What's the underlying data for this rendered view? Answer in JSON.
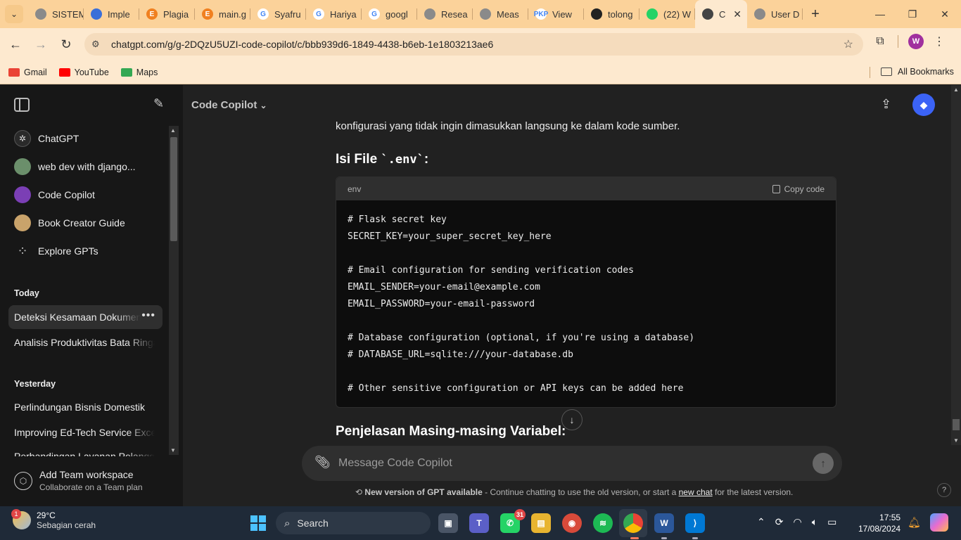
{
  "browser": {
    "tabs": [
      {
        "title": "SISTEM",
        "fav_color": "#8a8a8a",
        "fav_glyph": ""
      },
      {
        "title": "Imple",
        "fav_color": "#3a6fd8",
        "fav_glyph": ""
      },
      {
        "title": "Plagia",
        "fav_color": "#f08020",
        "fav_glyph": "E"
      },
      {
        "title": "main.g",
        "fav_color": "#f08020",
        "fav_glyph": "E"
      },
      {
        "title": "Syafru",
        "fav_color": "#ffffff",
        "fav_glyph": "G"
      },
      {
        "title": "Hariya",
        "fav_color": "#ffffff",
        "fav_glyph": "G"
      },
      {
        "title": "googl",
        "fav_color": "#ffffff",
        "fav_glyph": "G"
      },
      {
        "title": "Resea",
        "fav_color": "#8a8a8a",
        "fav_glyph": ""
      },
      {
        "title": "Meas",
        "fav_color": "#8a8a8a",
        "fav_glyph": ""
      },
      {
        "title": "View",
        "fav_color": "#ffffff",
        "fav_glyph": "PKP"
      },
      {
        "title": "tolong",
        "fav_color": "#222222",
        "fav_glyph": ""
      },
      {
        "title": "(22) W",
        "fav_color": "#25d366",
        "fav_glyph": ""
      },
      {
        "title": "C",
        "fav_color": "#444444",
        "fav_glyph": "",
        "active": true
      },
      {
        "title": "User D",
        "fav_color": "#8a8a8a",
        "fav_glyph": ""
      }
    ],
    "url": "chatgpt.com/g/g-2DQzU5UZI-code-copilot/c/bbb939d6-1849-4438-b6eb-1e1803213ae6",
    "bookmarks": [
      {
        "label": "Gmail",
        "color": "#ea4335"
      },
      {
        "label": "YouTube",
        "color": "#ff0000"
      },
      {
        "label": "Maps",
        "color": "#34a853"
      }
    ],
    "all_bookmarks": "All Bookmarks",
    "profile_initial": "W"
  },
  "sidebar": {
    "gpts": [
      {
        "label": "ChatGPT",
        "icon": "openai-icon",
        "color": "#2a2a2a"
      },
      {
        "label": "web dev with django...",
        "icon": "webdev-avatar",
        "color": "#6b8f6b"
      },
      {
        "label": "Code Copilot",
        "icon": "robot-avatar",
        "color": "#7b3fb5"
      },
      {
        "label": "Book Creator Guide",
        "icon": "book-avatar",
        "color": "#c9a36b"
      },
      {
        "label": "Explore GPTs",
        "icon": "grid-icon",
        "color": "transparent"
      }
    ],
    "today_label": "Today",
    "today": [
      {
        "label": "Deteksi Kesamaan Dokumen"
      },
      {
        "label": "Analisis Produktivitas Bata Ringan"
      }
    ],
    "yesterday_label": "Yesterday",
    "yesterday": [
      {
        "label": "Perlindungan Bisnis Domestik"
      },
      {
        "label": "Improving Ed-Tech Service Excellence"
      },
      {
        "label": "Perbandingan Layanan Pelanggan Ca"
      }
    ],
    "team_title": "Add Team workspace",
    "team_sub": "Collaborate on a Team plan"
  },
  "main": {
    "model_name": "Code Copilot",
    "prose_cut": "konfigurasi yang tidak ingin dimasukkan langsung ke dalam kode sumber.",
    "heading1_prefix": "Isi File ",
    "heading1_code": "`.env`",
    "heading1_suffix": ":",
    "code_lang": "env",
    "copy_label": "Copy code",
    "code_lines": [
      "# Flask secret key",
      "SECRET_KEY=your_super_secret_key_here",
      "",
      "# Email configuration for sending verification codes",
      "EMAIL_SENDER=your-email@example.com",
      "EMAIL_PASSWORD=your-email-password",
      "",
      "# Database configuration (optional, if you're using a database)",
      "# DATABASE_URL=sqlite:///your-database.db",
      "",
      "# Other sensitive configuration or API keys can be added here"
    ],
    "heading2": "Penjelasan Masing-masing Variabel:",
    "composer_placeholder": "Message Code Copilot",
    "notice_bold": "New version of GPT available",
    "notice_text": " - Continue chatting to use the old version, or start a ",
    "notice_link": "new chat",
    "notice_tail": " for the latest version.",
    "help": "?"
  },
  "taskbar": {
    "weather_temp": "29°C",
    "weather_desc": "Sebagian cerah",
    "weather_badge": "1",
    "search_label": "Search",
    "whatsapp_badge": "31",
    "time": "17:55",
    "date": "17/08/2024"
  }
}
